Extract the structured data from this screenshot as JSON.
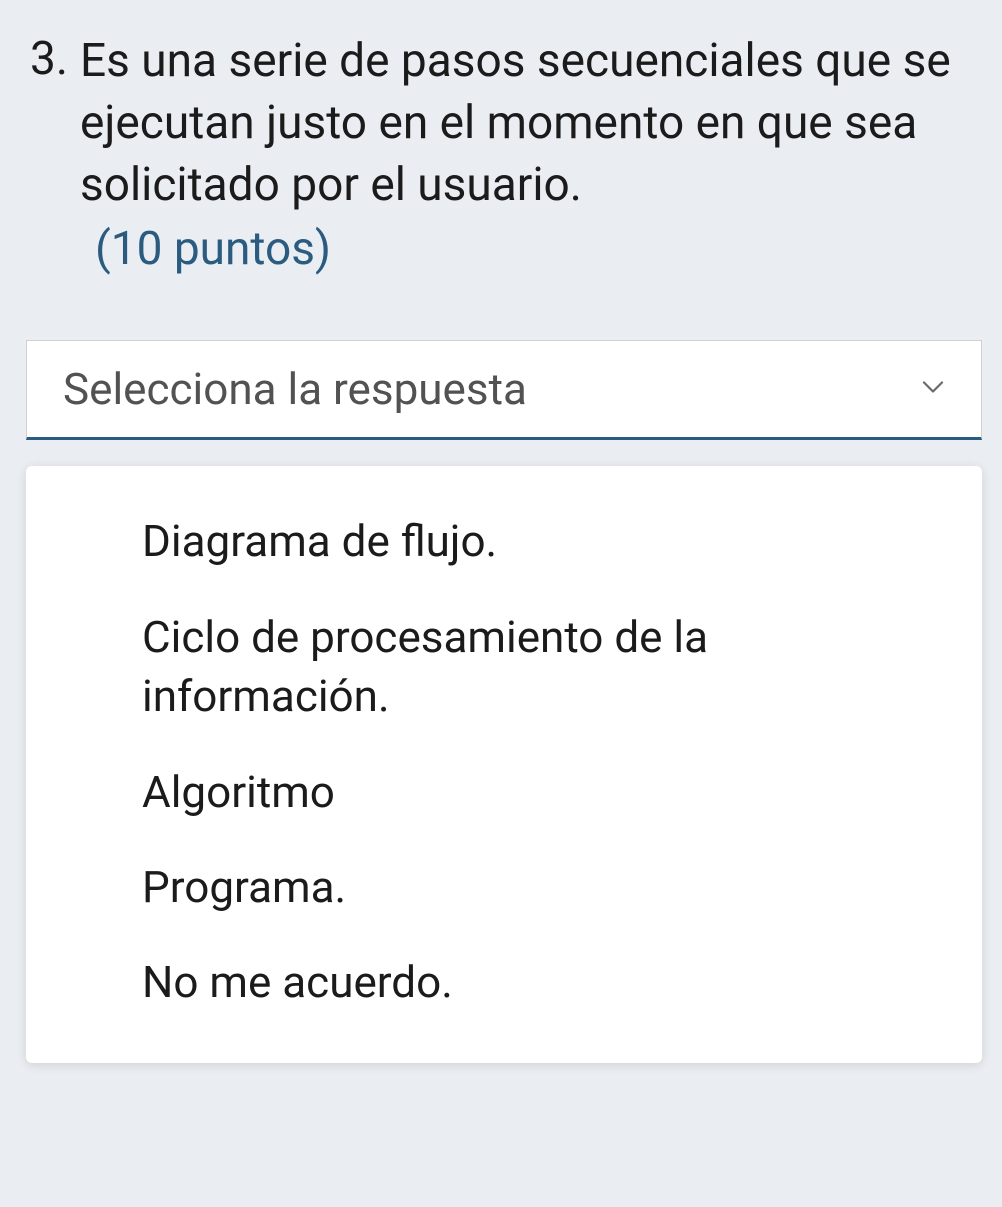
{
  "question": {
    "number": "3.",
    "text": "Es una serie de pasos secuenciales que se ejecutan justo en el momento en que sea solicitado por el usuario.",
    "points": "(10 puntos)"
  },
  "select": {
    "placeholder": "Selecciona la respuesta"
  },
  "options": [
    "Diagrama de flujo.",
    "Ciclo de procesamiento de la información.",
    "Algoritmo",
    "Programa.",
    "No me acuerdo."
  ]
}
